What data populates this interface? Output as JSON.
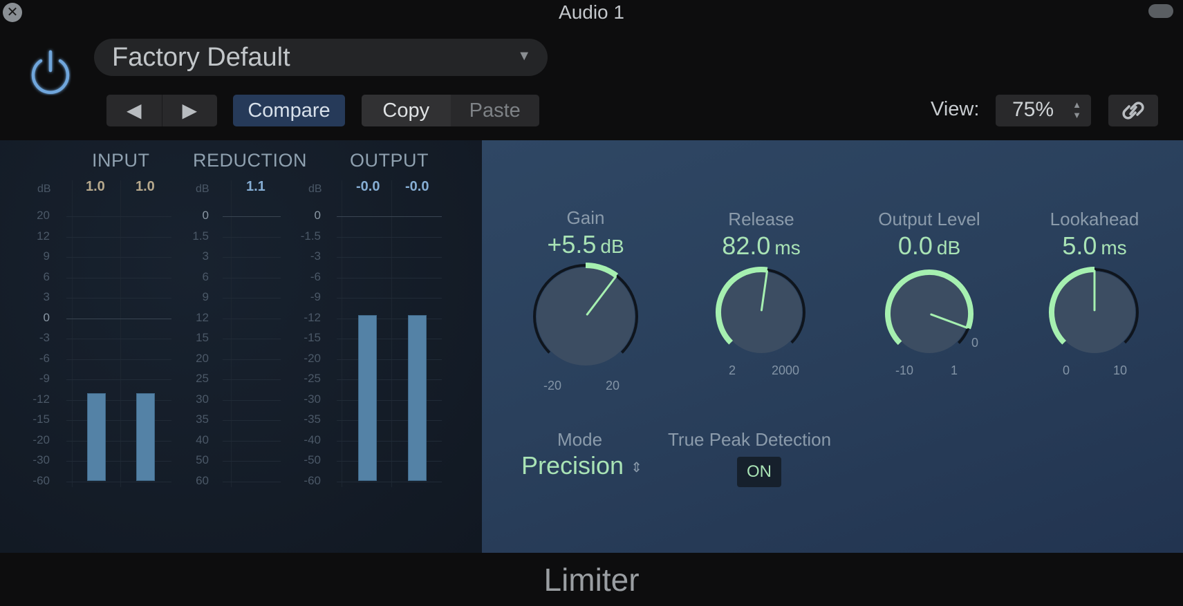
{
  "window": {
    "title": "Audio 1"
  },
  "header": {
    "preset_name": "Factory Default",
    "prev_label": "◀",
    "next_label": "▶",
    "compare_label": "Compare",
    "copy_label": "Copy",
    "paste_label": "Paste",
    "view_label": "View:",
    "view_value": "75%"
  },
  "icons": {
    "close": "close-icon",
    "power": "power-icon",
    "dropdown": "chevron-down-icon",
    "prev": "triangle-left-icon",
    "next": "triangle-right-icon",
    "stepper": "up-down-stepper-icon",
    "link": "link-icon"
  },
  "meters": {
    "db_unit": "dB",
    "input": {
      "title": "INPUT",
      "peaks": [
        "1.0",
        "1.0"
      ],
      "scale": [
        "20",
        "12",
        "9",
        "6",
        "3",
        "0",
        "-3",
        "-6",
        "-9",
        "-12",
        "-15",
        "-20",
        "-30",
        "-60"
      ],
      "levels_db": [
        -11,
        -11
      ]
    },
    "reduction": {
      "title": "REDUCTION",
      "peaks": [
        "1.1"
      ],
      "scale": [
        "0",
        "1.5",
        "3",
        "6",
        "9",
        "12",
        "15",
        "20",
        "25",
        "30",
        "35",
        "40",
        "50",
        "60"
      ],
      "levels_db": [
        0
      ]
    },
    "output": {
      "title": "OUTPUT",
      "peaks": [
        "-0.0",
        "-0.0"
      ],
      "scale": [
        "0",
        "-1.5",
        "-3",
        "-6",
        "-9",
        "-12",
        "-15",
        "-20",
        "-25",
        "-30",
        "-35",
        "-40",
        "-50",
        "-60"
      ],
      "levels_db": [
        -11.5,
        -11.5
      ]
    }
  },
  "knobs": [
    {
      "id": "gain",
      "label": "Gain",
      "value": "+5.5",
      "unit": "dB",
      "min_label": "-20",
      "max_label": "20",
      "min": -20,
      "max": 20,
      "current": 5.5,
      "fill_from": 0
    },
    {
      "id": "release",
      "label": "Release",
      "value": "82.0",
      "unit": "ms",
      "min_label": "2",
      "max_label": "2000",
      "min": 2,
      "max": 2000,
      "current": 82.0,
      "position": 0.53
    },
    {
      "id": "output-level",
      "label": "Output Level",
      "value": "0.0",
      "unit": "dB",
      "min_label": "-10",
      "max_label": "1",
      "zero_label": "0",
      "min": -10,
      "max": 1,
      "current": 0.0
    },
    {
      "id": "lookahead",
      "label": "Lookahead",
      "value": "5.0",
      "unit": "ms",
      "min_label": "0",
      "max_label": "10",
      "min": 0,
      "max": 10,
      "current": 5.0
    }
  ],
  "mode": {
    "label": "Mode",
    "value": "Precision"
  },
  "true_peak": {
    "label": "True Peak Detection",
    "value": "ON"
  },
  "footer": {
    "plugin_name": "Limiter"
  },
  "colors": {
    "accent_green": "#a9e3b5",
    "meter_bar": "#5482a6",
    "compare_active": "#263a59",
    "power_blue": "#6fa6dc"
  }
}
